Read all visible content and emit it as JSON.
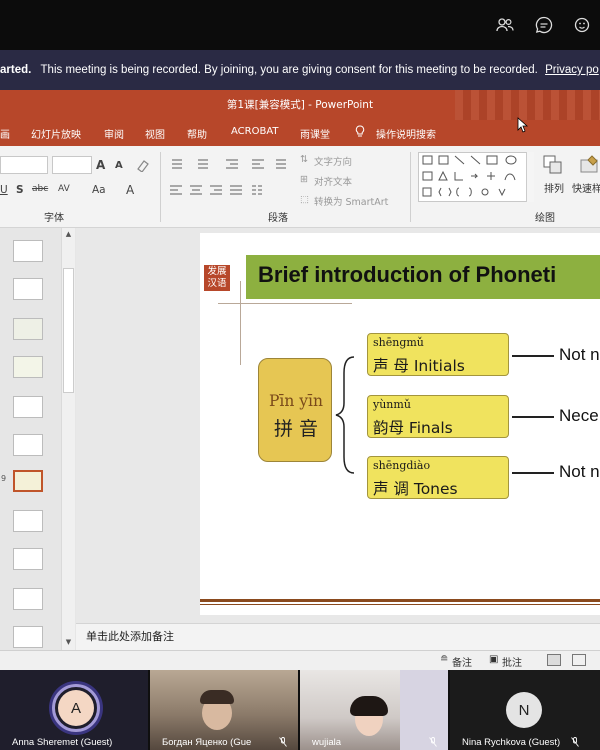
{
  "meeting": {
    "banner_start": "arted.",
    "banner_text": "This meeting is being recorded. By joining, you are giving consent for this meeting to be recorded.",
    "banner_link": "Privacy po",
    "top_icons": [
      "people-icon",
      "chat-icon",
      "reactions-icon"
    ],
    "participants": [
      {
        "name": "Anna Sheremet (Guest)",
        "initial": "A",
        "avatar_color": "#f4d7c4"
      },
      {
        "name": "Богдан Яценко (Gue",
        "initial": ""
      },
      {
        "name": "wujiala",
        "initial": ""
      },
      {
        "name": "Nina Rychkova (Guest)",
        "initial": "N",
        "avatar_color": "#e4e4e4"
      }
    ]
  },
  "ppt": {
    "title": "第1课[兼容模式]  -  PowerPoint",
    "tabs": [
      "画",
      "幻灯片放映",
      "审阅",
      "视图",
      "帮助",
      "ACROBAT",
      "雨课堂",
      "操作说明搜索"
    ],
    "groups": {
      "font": "字体",
      "paragraph": "段落",
      "drawing": "绘图"
    },
    "ribbon_text": {
      "text_direction": "文字方向",
      "align_text": "对齐文本",
      "smartart": "转换为 SmartArt",
      "arrange": "排列",
      "quick_style": "快速样式",
      "font_size_a": "A",
      "case": "Aa",
      "font_color_a": "A",
      "fmt": [
        "U",
        "S",
        "abc",
        "AV"
      ]
    },
    "thumbs_numbers": [
      "",
      "",
      "",
      "",
      "",
      "",
      "9",
      "",
      "",
      "",
      ""
    ],
    "notes_placeholder": "单击此处添加备注",
    "status": {
      "notes": "备注",
      "comments": "批注"
    },
    "brand": [
      "发展",
      "汉语"
    ],
    "colors": {
      "accent": "#b7472a",
      "slide_bar": "#8db040",
      "box": "#f0e35e",
      "pinyin_box": "#e6c653"
    }
  },
  "slide": {
    "title": "Brief introduction of Phoneti",
    "main_pinyin": "Pīn yīn",
    "main_hanzi": "拼 音",
    "items": [
      {
        "pinyin": "shēngmǔ",
        "label": "声  母  Initials",
        "note": "Not n"
      },
      {
        "pinyin": "yùnmǔ",
        "label": "韵母  Finals",
        "note": "Nece"
      },
      {
        "pinyin": "shēngdiào",
        "label": "声    调   Tones",
        "note": "Not n"
      }
    ]
  }
}
